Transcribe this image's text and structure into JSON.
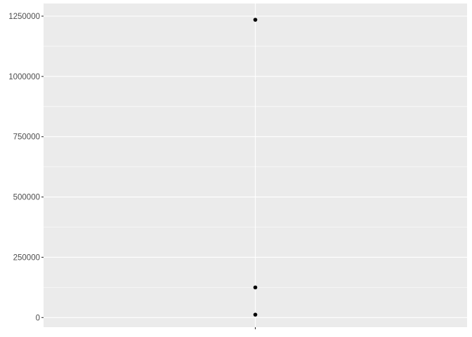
{
  "chart_data": {
    "type": "scatter",
    "title": "",
    "xlabel": "",
    "ylabel": "",
    "x_categories": [
      ""
    ],
    "points": [
      {
        "x": "",
        "y": 1235000
      },
      {
        "x": "",
        "y": 125000
      },
      {
        "x": "",
        "y": 12000
      }
    ],
    "ylim": [
      -30000,
      1300000
    ],
    "y_ticks": [
      0,
      250000,
      500000,
      750000,
      1000000,
      1250000
    ],
    "y_tick_labels": [
      "0",
      "250000",
      "500000",
      "750000",
      "1000000",
      "1250000"
    ],
    "grid": true,
    "legend": "none",
    "colors": {
      "panel": "#ebebeb",
      "grid": "#ffffff",
      "point": "#000000",
      "text": "#4d4d4d",
      "tick": "#333333"
    }
  }
}
